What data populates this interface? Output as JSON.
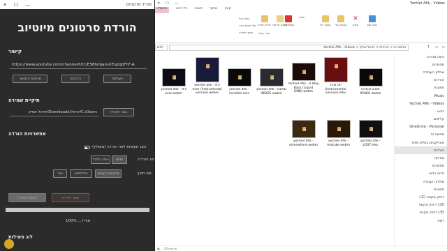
{
  "app": {
    "window_title": "מוריד סרטונים",
    "heading": "הורדת סרטונים מיוטיוב",
    "link_section": {
      "title": "קישור",
      "url_value": "https://www.youtube.com/channel/UCUESBhdqaosXEsjzqbFhF-A",
      "buttons": [
        "העתקה",
        "הדבקה",
        "מחיקת הקישור"
      ]
    },
    "save_section": {
      "title": "תיקיית שמירה",
      "path_value": "C:/Users/‏יחיאל/Downloads/‏יחיאל אפיק",
      "browse_label": "בחר תיקייה"
    },
    "options_section": {
      "title": "אפשרויות הורדה",
      "toggle_label": "הצג תוצאות לפני הורדה (מומלץ)",
      "download_type_label": "סוג הורדה:",
      "download_type_options": [
        "וידאו",
        "אודיו בלבד"
      ],
      "content_type_label": "סוג תוכן:",
      "content_type_options": [
        "שיר",
        "פלייליסט",
        "סרטונים בערוץ"
      ]
    },
    "actions": {
      "stop_label": "עצור הורדה",
      "start_label": "התחל הורדה"
    },
    "progress": {
      "value": 1.0,
      "text": "100% ...מוריד"
    },
    "log_title": "לוג פעילות"
  },
  "explorer": {
    "title_bar": "Yechiel Afik - Videos",
    "ribbon_tabs": [
      "קובץ",
      "שיתוף",
      "תצוגה",
      "כלי וידאו",
      "הפעלה"
    ],
    "active_tab": "הפעלה",
    "ribbon_items": [
      "פריט חדש",
      "גישה קלה",
      "תיקיה חדשה",
      "מאפיינים",
      "פתח",
      "בחר הכל",
      "אל תבחר דבר",
      "הפוך בחירה",
      "העבר אל",
      "העתק אל",
      "מחק",
      "שנה שם"
    ],
    "address_path": "מחשב זה > הורדות > יחיאל אפיק > Yechiel Afik - Videos",
    "search_placeholder": "חפש",
    "nav_items": [
      "גישה מהירה",
      "מסמכים",
      "שולחן העבודה",
      "הורדות",
      "תמונות",
      "Music",
      "Yechiel Afik - Videos",
      "וידאו",
      "קליפים",
      "OneDrive - Personal",
      "מחשב זה",
      "אובייקטים בתלת מימד",
      "הורדות",
      "מוזיקה",
      "מסמכים",
      "סרטי וידאו",
      "שולחן העבודה",
      "תמונות",
      "דיסק מקומי (C:)",
      "(D:) דיסק מקומי",
      "(E:) דיסק מקומי",
      "רשת"
    ],
    "selected_nav": "הורדות",
    "files": [
      {
        "name": "yechiel afik - It's over.webm"
      },
      {
        "name": "yechiel afik - It's over (Instrumental version).webm"
      },
      {
        "name": "yechiel afik - invisible.mkv"
      },
      {
        "name": "yechiel afik - DEAD INSIDE.webm"
      },
      {
        "name": "Yechiel Afik - A Way Back (Liquid DNB).webm"
      },
      {
        "name": "FED UP (Instrumental version).mkv"
      },
      {
        "name": "CHILD (LIVE BAND).webm"
      },
      {
        "name": "yechiel afik - somewhere.webm"
      },
      {
        "name": "yechiel afik - mistake.webm"
      },
      {
        "name": "yechiel afik - LOST.mkv"
      }
    ],
    "status_items": [
      "10 פריטים"
    ]
  },
  "colors": {
    "app_bg": "#2b2b2b",
    "stop_red": "#c0392b",
    "explorer_bg": "#ffffff",
    "active_tab": "#f0c0d8"
  }
}
